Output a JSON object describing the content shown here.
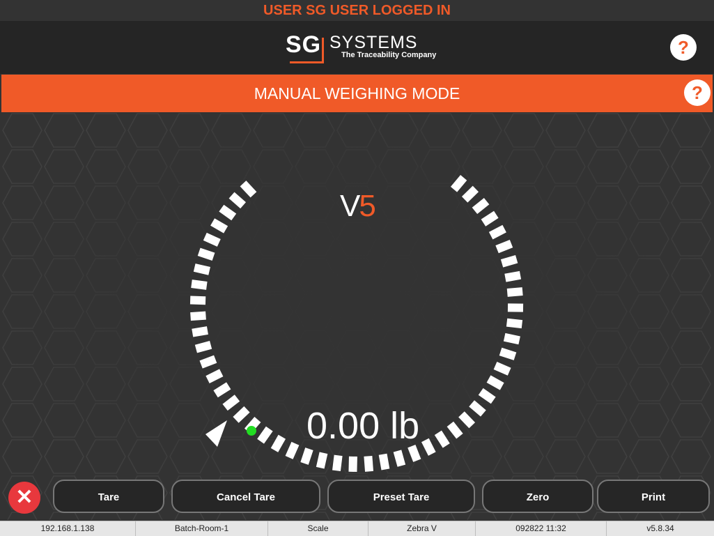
{
  "banner": {
    "text": "USER SG USER LOGGED IN"
  },
  "logo": {
    "sg": "SG",
    "systems": "SYSTEMS",
    "tagline": "The Traceability Company"
  },
  "header": {
    "help_label": "?"
  },
  "mode": {
    "title": "MANUAL WEIGHING MODE",
    "help_label": "?"
  },
  "gauge": {
    "brand_v": "V",
    "brand_5": "5",
    "weight": "0.00 lb",
    "stable": true
  },
  "buttons": {
    "close_label": "✕",
    "tare": "Tare",
    "cancel_tare": "Cancel Tare",
    "preset_tare": "Preset Tare",
    "zero": "Zero",
    "print": "Print"
  },
  "status": [
    "192.168.1.138",
    "Batch-Room-1",
    "Scale",
    "Zebra V",
    "092822 11:32",
    "v5.8.34"
  ],
  "colors": {
    "accent": "#F05A28",
    "background": "#333333",
    "header": "#252525",
    "stable": "#22dd22",
    "close": "#e8383d"
  }
}
